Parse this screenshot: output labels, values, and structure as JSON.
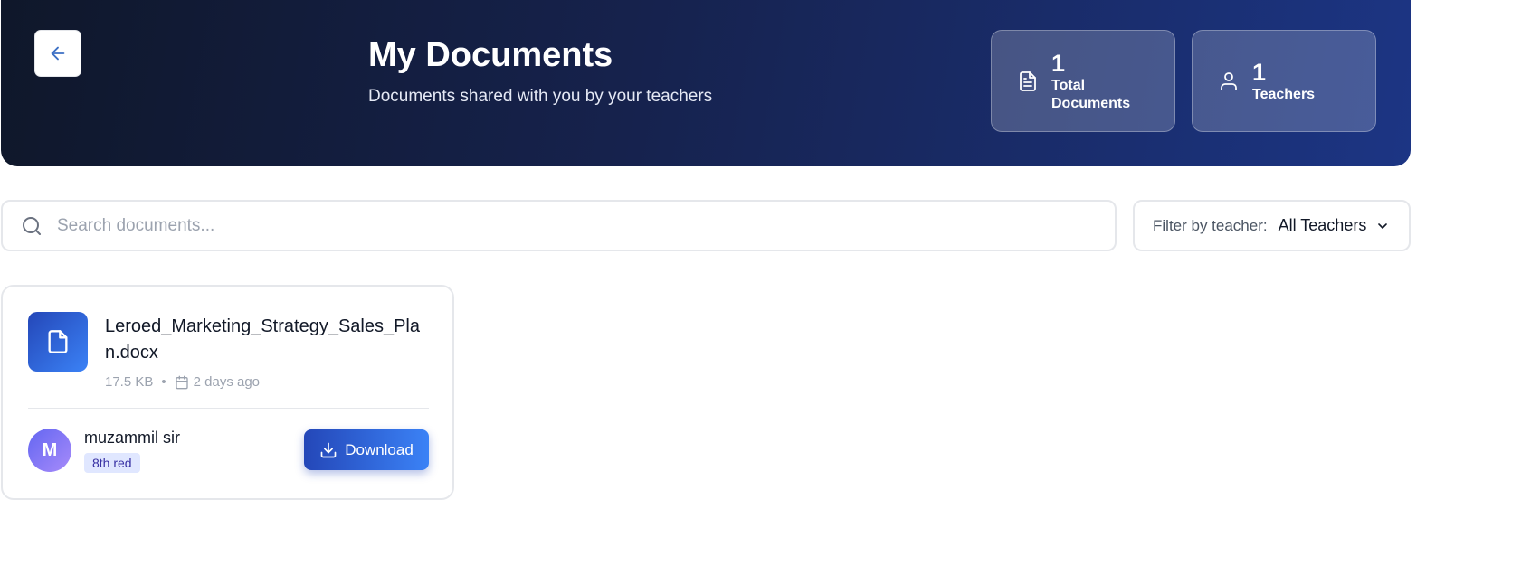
{
  "header": {
    "title": "My Documents",
    "subtitle": "Documents shared with you by your teachers",
    "back_icon": "arrow-left-icon",
    "stats": [
      {
        "value": "1",
        "label_line1": "Total",
        "label_line2": "Documents",
        "icon": "document-icon"
      },
      {
        "value": "1",
        "label_line1": "Teachers",
        "icon": "user-icon"
      }
    ]
  },
  "search": {
    "placeholder": "Search documents...",
    "value": ""
  },
  "filter": {
    "label": "Filter by teacher:",
    "selected": "All Teachers"
  },
  "documents": [
    {
      "file_name": "Leroed_Marketing_Strategy_Sales_Plan.docx",
      "size": "17.5 KB",
      "separator": "•",
      "date": "2 days ago",
      "teacher": {
        "initial": "M",
        "name": "muzammil sir",
        "class": "8th red"
      },
      "download_label": "Download"
    }
  ],
  "colors": {
    "header_start": "#0f172a",
    "header_end": "#1c3584",
    "accent": "#2447b8",
    "accent_light": "#3b82f6"
  }
}
